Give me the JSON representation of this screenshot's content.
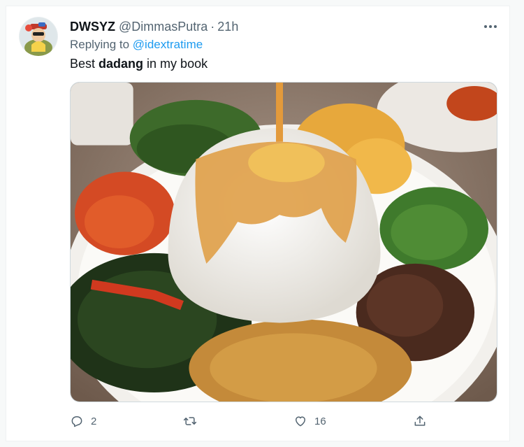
{
  "tweet": {
    "display_name": "DWSYZ",
    "handle": "@DimmasPutra",
    "separator": "·",
    "time": "21h",
    "reply_prefix": "Replying to ",
    "reply_to": "@idextratime",
    "text_before": "Best ",
    "text_bold": "dadang",
    "text_after": " in my book",
    "media_description_icon": "photo-of-rice-plate"
  },
  "actions": {
    "reply_count": "2",
    "retweet_count": "",
    "like_count": "16"
  },
  "colors": {
    "link": "#1d9bf0",
    "muted": "#536471",
    "text": "#0f1419"
  }
}
